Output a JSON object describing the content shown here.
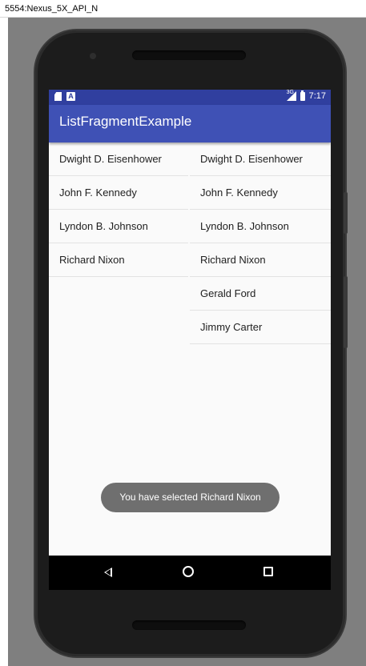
{
  "window": {
    "title": "5554:Nexus_5X_API_N"
  },
  "statusbar": {
    "time": "7:17",
    "network_label": "3G",
    "icons": [
      "sd-card-icon",
      "a-notification-icon",
      "signal-icon",
      "battery-icon"
    ],
    "a_label": "A"
  },
  "appbar": {
    "title": "ListFragmentExample"
  },
  "colors": {
    "statusbar": "#303f9f",
    "appbar": "#3f51b5",
    "toast": "#6f6f6f",
    "screen_bg": "#fafafa",
    "emulator_bg": "#7f7f7f"
  },
  "list_left": {
    "items": [
      "Dwight D. Eisenhower",
      "John F. Kennedy",
      "Lyndon B. Johnson",
      "Richard Nixon"
    ]
  },
  "list_right": {
    "items": [
      "Dwight D. Eisenhower",
      "John F. Kennedy",
      "Lyndon B. Johnson",
      "Richard Nixon",
      "Gerald Ford",
      "Jimmy Carter"
    ]
  },
  "toast": {
    "text": "You have selected Richard Nixon"
  },
  "navbar": {
    "icons": [
      "back-icon",
      "home-icon",
      "recents-icon"
    ]
  }
}
